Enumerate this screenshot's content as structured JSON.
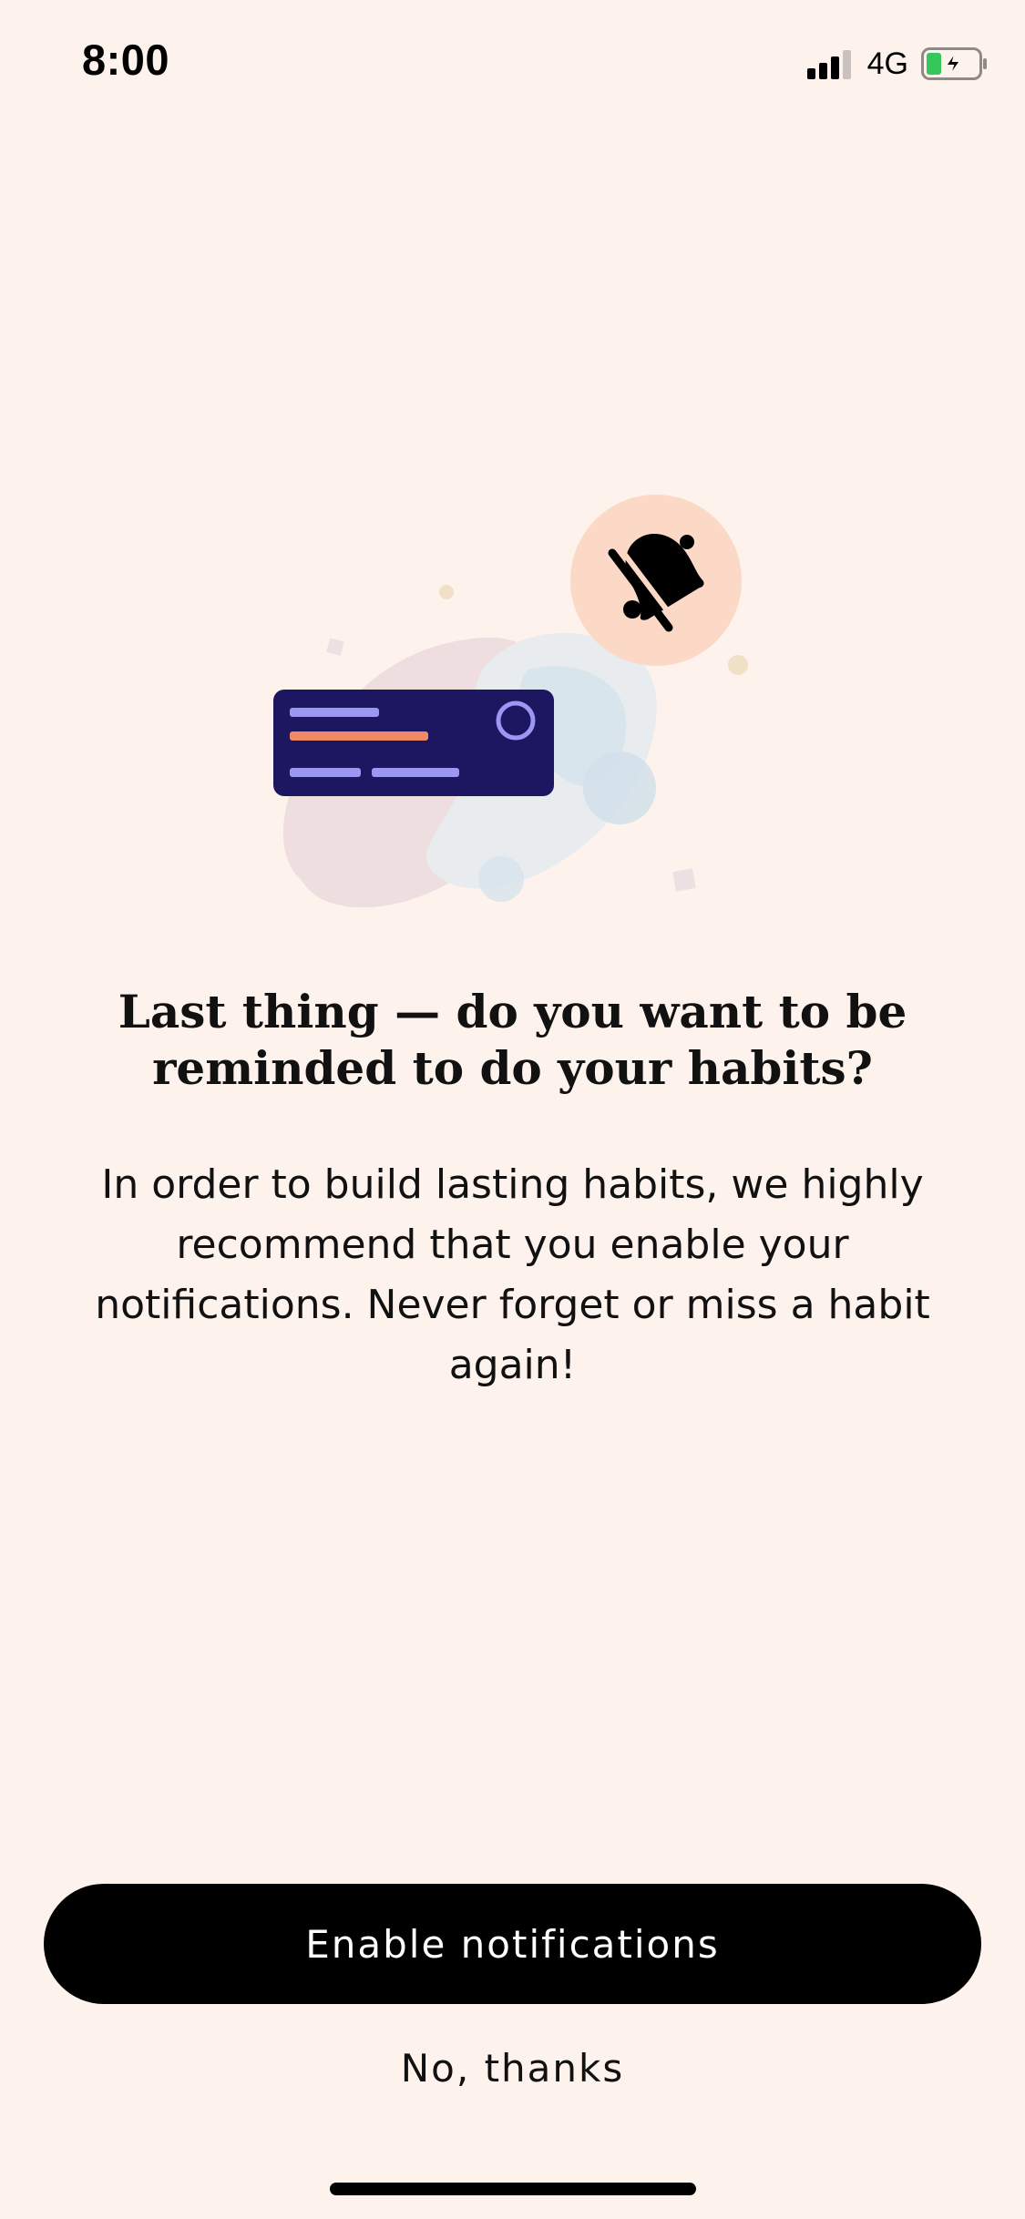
{
  "status_bar": {
    "time": "8:00",
    "network": "4G",
    "icons": [
      "signal-icon",
      "battery-charging-icon"
    ]
  },
  "illustration": {
    "icons": [
      "bell-slash-icon",
      "notification-card-icon"
    ],
    "colors": {
      "card": "#1c1760",
      "card_lines": "#9b97f2",
      "card_accent_line": "#f08a64",
      "bell_circle": "#fcd8c6"
    }
  },
  "content": {
    "title": "Last thing — do you want to be reminded to do your habits?",
    "description": "In order to build lasting habits, we highly recommend that you enable your notifications. Never forget or miss a habit again!"
  },
  "actions": {
    "enable_label": "Enable notifications",
    "decline_label": "No, thanks"
  },
  "colors": {
    "background": "#fdf2ec",
    "primary_button": "#000000",
    "primary_button_text": "#ffffff"
  }
}
